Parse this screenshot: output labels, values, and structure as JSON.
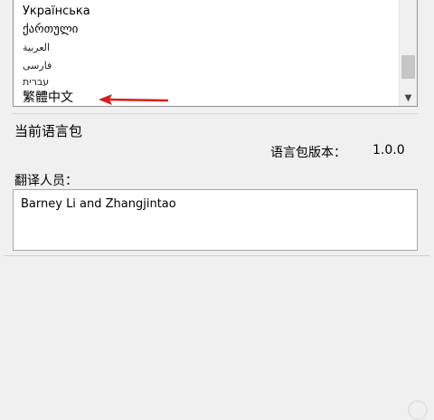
{
  "language_list": {
    "items": [
      {
        "label": "Українська"
      },
      {
        "label": "ქართული"
      },
      {
        "label": "العربية"
      },
      {
        "label": "فارسی"
      },
      {
        "label": "עברית"
      },
      {
        "label": "繁體中文"
      }
    ],
    "selected_label": "繁體中文"
  },
  "current_pack": {
    "section_title": "当前语言包",
    "version_label": "语言包版本：",
    "version_value": "1.0.0",
    "translators_label": "翻译人员：",
    "translators_value": "Barney Li and Zhangjintao"
  },
  "icons": {
    "scroll_down": "chevron-down-icon",
    "annotation_arrow": "red-arrow-icon"
  },
  "colors": {
    "arrow": "#d81e1e"
  }
}
